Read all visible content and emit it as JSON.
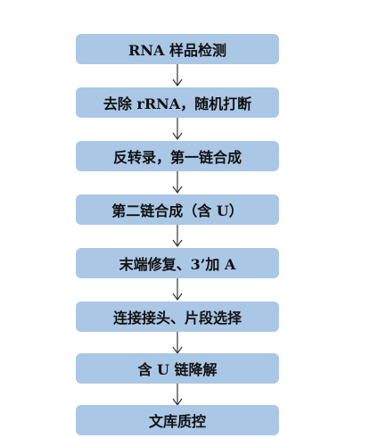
{
  "steps": [
    {
      "label": "RNA 样品检测"
    },
    {
      "label": "去除 rRNA，随机打断"
    },
    {
      "label": "反转录，第一链合成"
    },
    {
      "label": "第二链合成（含 U）"
    },
    {
      "label": "末端修复、3’加 A"
    },
    {
      "label": "连接接头、片段选择"
    },
    {
      "label": "含 U 链降解"
    },
    {
      "label": "文库质控"
    }
  ],
  "colors": {
    "box_fill": "#aac7e6",
    "arrow": "#333333",
    "text": "#111111"
  }
}
